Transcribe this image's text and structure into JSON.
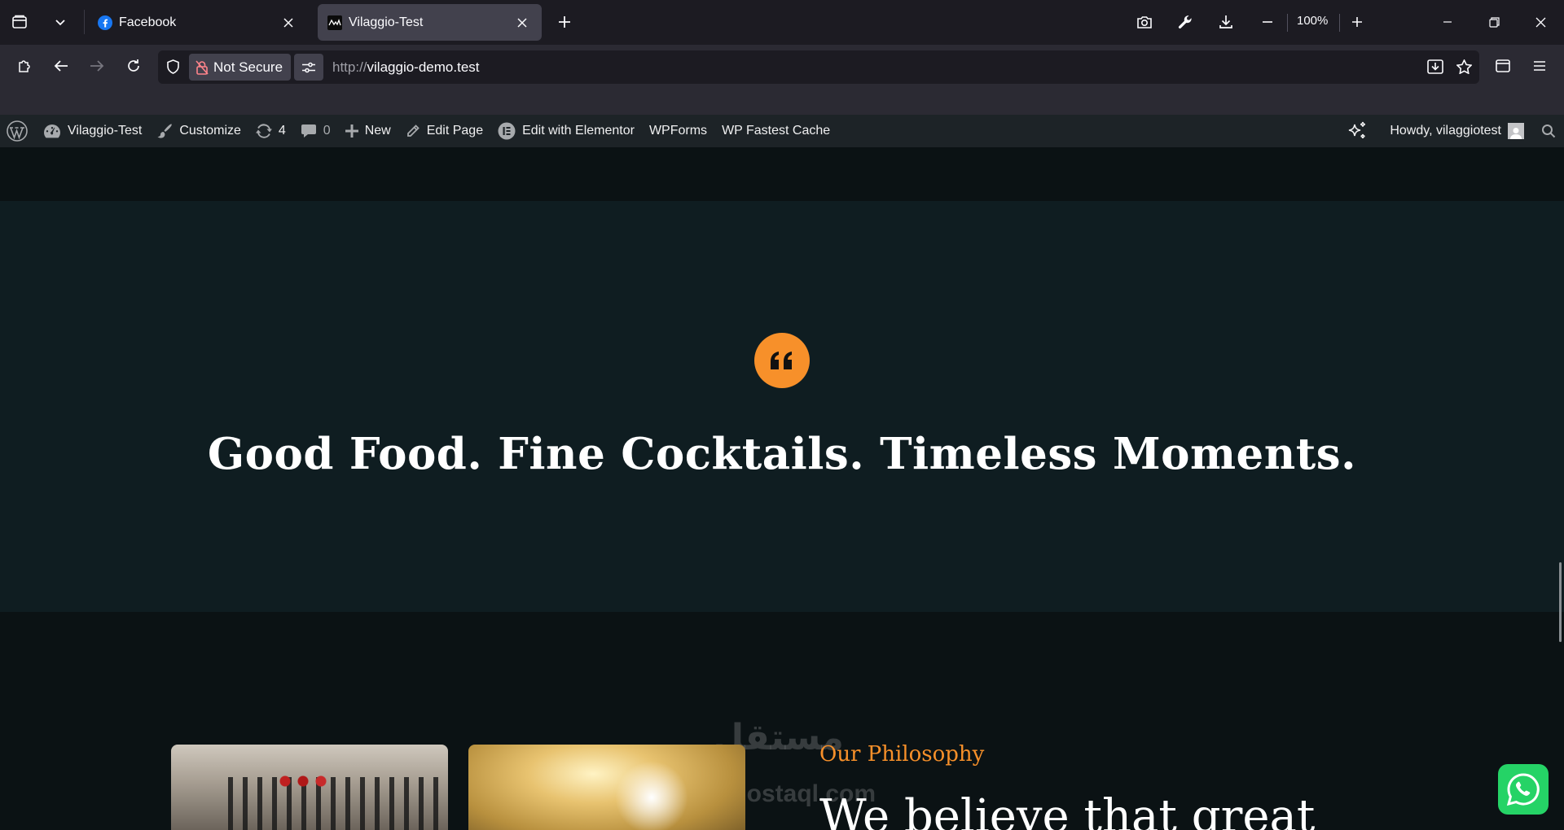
{
  "browser": {
    "tabs": [
      {
        "title": "Facebook",
        "favicon": "facebook-icon",
        "active": false
      },
      {
        "title": "Vilaggio-Test",
        "favicon": "vilaggio-favicon",
        "active": true
      }
    ],
    "zoom": "100%",
    "security_label": "Not Secure",
    "url_scheme": "http://",
    "url_host": "vilaggio-demo.test",
    "accent": "#42414d"
  },
  "adminbar": {
    "site_name": "Vilaggio-Test",
    "customize": "Customize",
    "updates_count": "4",
    "comments_count": "0",
    "new": "New",
    "edit_page": "Edit Page",
    "edit_elementor": "Edit with Elementor",
    "wpforms": "WPForms",
    "fastest_cache": "WP Fastest Cache",
    "howdy": "Howdy, vilaggiotest",
    "background": "#1d2327"
  },
  "hero": {
    "title": "Good Food. Fine Cocktails. Timeless Moments.",
    "icon": "quote-icon",
    "accent": "#f7902a"
  },
  "philosophy": {
    "kicker": "Our Philosophy",
    "heading": "We believe that great"
  },
  "watermark": {
    "arabic": "مستقل",
    "latin": "mostaql.com"
  }
}
